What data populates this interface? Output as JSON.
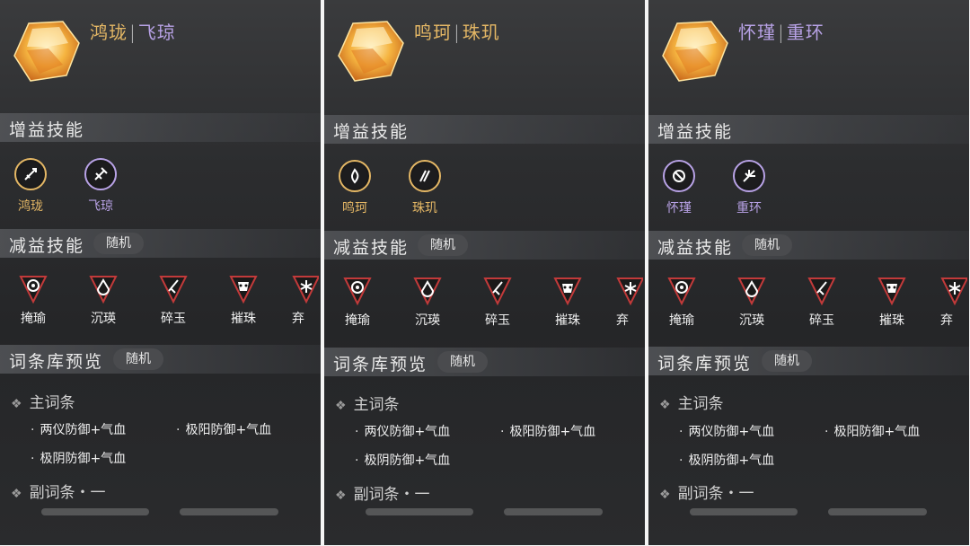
{
  "panels": [
    {
      "title_a": "鸿珑",
      "title_b": "飞琼",
      "title_a_color": "#e4b765",
      "title_b_color": "#b8a2e6",
      "buff_header": "增益技能",
      "buffs": [
        {
          "label": "鸿珑",
          "color": "#e4b765",
          "icon": "sword-icon"
        },
        {
          "label": "飞琼",
          "color": "#b8a2e6",
          "icon": "spear-icon"
        }
      ],
      "debuff_header": "减益技能",
      "debuff_tag": "随机",
      "debuffs": [
        "掩瑜",
        "沉瑛",
        "碎玉",
        "摧珠",
        "弃"
      ],
      "pool_header": "词条库预览",
      "pool_tag": "随机",
      "main_label": "主词条",
      "main_entries": [
        "两仪防御+气血",
        "极阳防御+气血",
        "极阴防御+气血"
      ],
      "secondary_label": "副词条・一"
    },
    {
      "title_a": "鸣珂",
      "title_b": "珠玑",
      "title_a_color": "#e4b765",
      "title_b_color": "#e4b765",
      "buff_header": "增益技能",
      "buffs": [
        {
          "label": "鸣珂",
          "color": "#e4b765",
          "icon": "flame-icon"
        },
        {
          "label": "珠玑",
          "color": "#e4b765",
          "icon": "claw-icon"
        }
      ],
      "debuff_header": "减益技能",
      "debuff_tag": "随机",
      "debuffs": [
        "掩瑜",
        "沉瑛",
        "碎玉",
        "摧珠",
        "弃"
      ],
      "pool_header": "词条库预览",
      "pool_tag": "随机",
      "main_label": "主词条",
      "main_entries": [
        "两仪防御+气血",
        "极阳防御+气血",
        "极阴防御+气血"
      ],
      "secondary_label": "副词条・一"
    },
    {
      "title_a": "怀瑾",
      "title_b": "重环",
      "title_a_color": "#b8a2e6",
      "title_b_color": "#b8a2e6",
      "buff_header": "增益技能",
      "buffs": [
        {
          "label": "怀瑾",
          "color": "#b8a2e6",
          "icon": "orb-icon"
        },
        {
          "label": "重环",
          "color": "#b8a2e6",
          "icon": "burst-icon"
        }
      ],
      "debuff_header": "减益技能",
      "debuff_tag": "随机",
      "debuffs": [
        "掩瑜",
        "沉瑛",
        "碎玉",
        "摧珠",
        "弃"
      ],
      "pool_header": "词条库预览",
      "pool_tag": "随机",
      "main_label": "主词条",
      "main_entries": [
        "两仪防御+气血",
        "极阳防御+气血",
        "极阴防御+气血"
      ],
      "secondary_label": "副词条・一"
    }
  ]
}
